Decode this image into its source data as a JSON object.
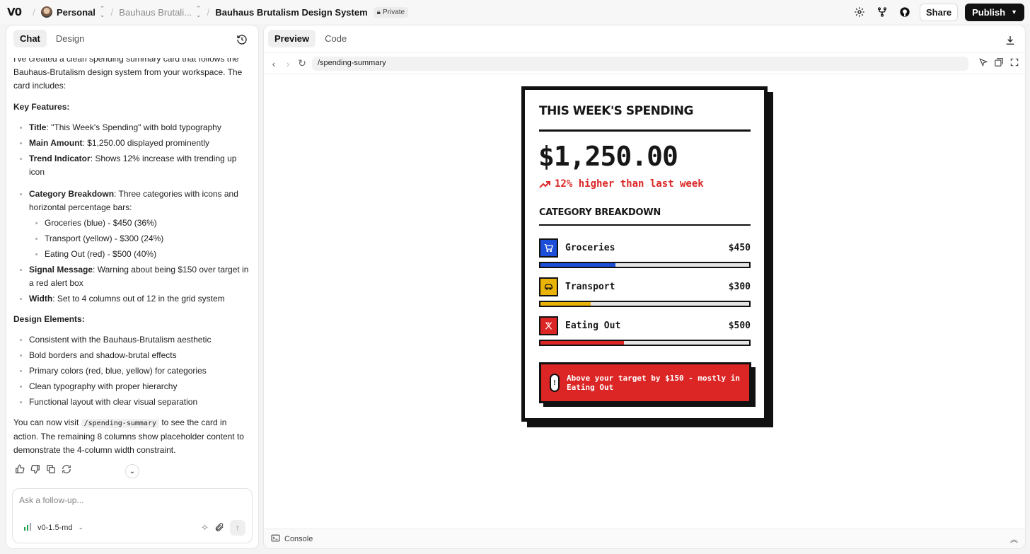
{
  "topbar": {
    "logo": "V0",
    "workspace": "Personal",
    "project_short": "Bauhaus Brutali...",
    "project_title": "Bauhaus Brutalism Design System",
    "privacy_badge": "Private",
    "share_label": "Share",
    "publish_label": "Publish"
  },
  "chat": {
    "tabs": [
      "Chat",
      "Design"
    ],
    "intro": "I've created a clean spending summary card that follows the Bauhaus-Brutalism design system from your workspace. The card includes:",
    "key_features_heading": "Key Features:",
    "features": [
      {
        "bold": "Title",
        "text": ": \"This Week's Spending\" with bold typography"
      },
      {
        "bold": "Main Amount",
        "text": ": $1,250.00 displayed prominently"
      },
      {
        "bold": "Trend Indicator",
        "text": ": Shows 12% increase with trending up icon"
      },
      {
        "bold": "Category Breakdown",
        "text": ": Three categories with icons and horizontal percentage bars:"
      }
    ],
    "sub_features": [
      "Groceries (blue) - $450 (36%)",
      "Transport (yellow) - $300 (24%)",
      "Eating Out (red) - $500 (40%)"
    ],
    "features_after": [
      {
        "bold": "Signal Message",
        "text": ": Warning about being $150 over target in a red alert box"
      },
      {
        "bold": "Width",
        "text": ": Set to 4 columns out of 12 in the grid system"
      }
    ],
    "design_heading": "Design Elements:",
    "design_items": [
      "Consistent with the Bauhaus-Brutalism aesthetic",
      "Bold borders and shadow-brutal effects",
      "Primary colors (red, blue, yellow) for categories",
      "Clean typography with proper hierarchy",
      "Functional layout with clear visual separation"
    ],
    "outro_before": "You can now visit ",
    "outro_code": "/spending-summary",
    "outro_after": " to see the card in action. The remaining 8 columns show placeholder content to demonstrate the 4-column width constraint.",
    "followup_placeholder": "Ask a follow-up...",
    "model": "v0-1.5-md"
  },
  "preview": {
    "tabs": [
      "Preview",
      "Code"
    ],
    "url": "/spending-summary",
    "console_label": "Console"
  },
  "card": {
    "title": "THIS WEEK'S SPENDING",
    "amount": "$1,250.00",
    "trend": "12% higher than last week",
    "breakdown_title": "CATEGORY BREAKDOWN",
    "categories": [
      {
        "name": "Groceries",
        "value": "$450",
        "percent": 36,
        "color": "#1d4ed8"
      },
      {
        "name": "Transport",
        "value": "$300",
        "percent": 24,
        "color": "#eab308"
      },
      {
        "name": "Eating Out",
        "value": "$500",
        "percent": 40,
        "color": "#dc2626"
      }
    ],
    "alert": "Above your target by $150 - mostly in Eating Out"
  },
  "colors": {
    "accent_red": "#dc2626",
    "blue": "#1d4ed8",
    "yellow": "#eab308",
    "ink": "#111111"
  }
}
